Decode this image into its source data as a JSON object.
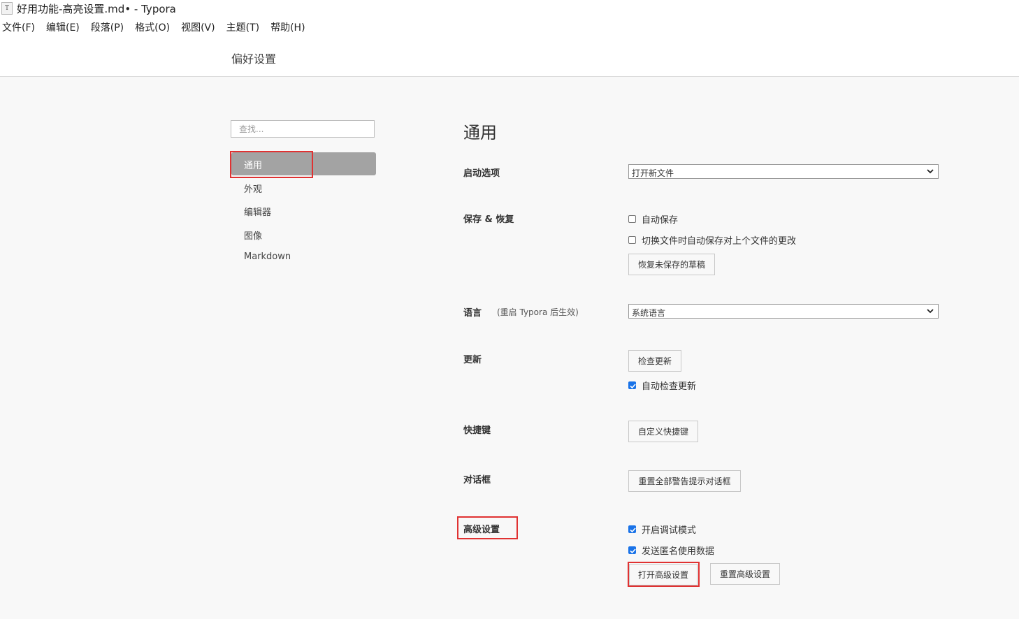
{
  "window": {
    "app_icon_glyph": "T",
    "title": "好用功能-高亮设置.md• - Typora"
  },
  "menubar": [
    "文件(F)",
    "编辑(E)",
    "段落(P)",
    "格式(O)",
    "视图(V)",
    "主题(T)",
    "帮助(H)"
  ],
  "preferences_heading": "偏好设置",
  "sidebar": {
    "search_placeholder": "查找...",
    "items": [
      {
        "label": "通用",
        "active": true
      },
      {
        "label": "外观",
        "active": false
      },
      {
        "label": "编辑器",
        "active": false
      },
      {
        "label": "图像",
        "active": false
      },
      {
        "label": "Markdown",
        "active": false
      }
    ]
  },
  "main": {
    "section_title": "通用",
    "startup": {
      "label": "启动选项",
      "selected": "打开新文件"
    },
    "save_restore": {
      "label": "保存 & 恢复",
      "autosave": {
        "label": "自动保存",
        "checked": false
      },
      "autosave_on_switch": {
        "label": "切换文件时自动保存对上个文件的更改",
        "checked": false
      },
      "recover_button": "恢复未保存的草稿"
    },
    "language": {
      "label": "语言",
      "note": "(重启 Typora 后生效)",
      "selected": "系统语言"
    },
    "update": {
      "label": "更新",
      "check_button": "检查更新",
      "auto_check": {
        "label": "自动检查更新",
        "checked": true
      }
    },
    "shortcuts": {
      "label": "快捷键",
      "button": "自定义快捷键"
    },
    "dialogs": {
      "label": "对话框",
      "button": "重置全部警告提示对话框"
    },
    "advanced": {
      "label": "高级设置",
      "debug_mode": {
        "label": "开启调试模式",
        "checked": true
      },
      "send_usage": {
        "label": "发送匿名使用数据",
        "checked": true
      },
      "open_button": "打开高级设置",
      "reset_button": "重置高级设置"
    }
  },
  "colors": {
    "highlight": "#e03232",
    "checkbox_checked": "#1a73e8",
    "sidebar_active": "#a3a3a3"
  }
}
